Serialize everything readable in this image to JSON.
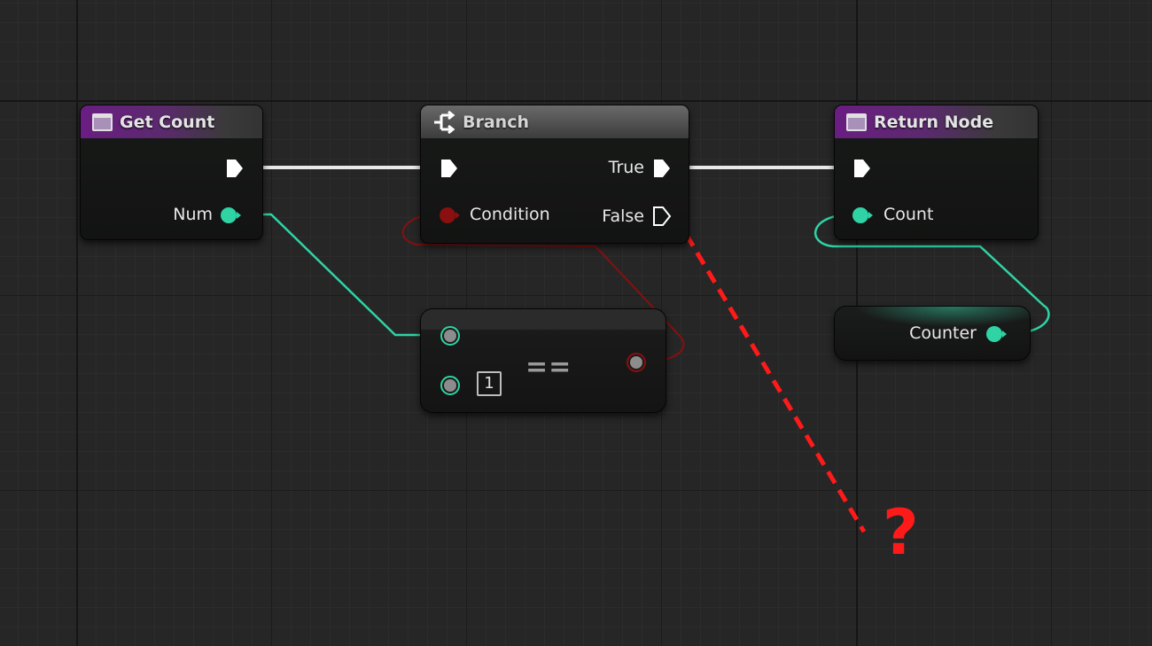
{
  "graph": {
    "nodes": {
      "get_count": {
        "title": "Get Count",
        "output_label": "Num"
      },
      "branch": {
        "title": "Branch",
        "input_label": "Condition",
        "true_label": "True",
        "false_label": "False"
      },
      "return_node": {
        "title": "Return Node",
        "input_label": "Count"
      },
      "equals": {
        "operator": "==",
        "literal_value": "1"
      },
      "counter": {
        "label": "Counter"
      }
    },
    "annotation": {
      "text": "?"
    }
  },
  "colors": {
    "exec_wire": "#ffffff",
    "integer_wire": "#2fd3a4",
    "boolean_wire": "#8a0f0f",
    "function_header": "#6a1d82",
    "annotation": "#ff1a1a"
  },
  "icons": [
    "function-icon",
    "branch-icon",
    "exec-pin-icon",
    "data-pin-icon"
  ]
}
